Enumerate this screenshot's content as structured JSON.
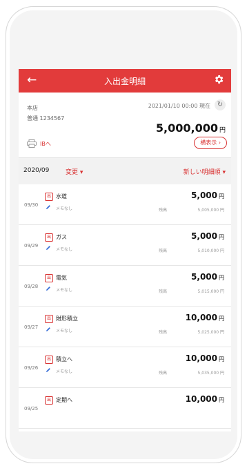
{
  "header": {
    "back_icon": "arrow-left-icon",
    "title": "入出金明細",
    "settings_icon": "gear-icon"
  },
  "account": {
    "branch": "本店",
    "account_type_number": "普通 1234567",
    "datetime": "2021/01/10 00:00 現在",
    "refresh_icon": "refresh-icon",
    "balance": "5,000,000",
    "currency": "円",
    "ib_link": "IBへ",
    "landscape_button": "横表示 ›",
    "print_icon": "printer-icon"
  },
  "filter": {
    "month": "2020/09",
    "change": "変更 ▾",
    "sort": "新しい明細順 ▾"
  },
  "transactions": [
    {
      "date": "09/30",
      "badge": "出",
      "desc": "水道",
      "memo": "メモなし",
      "amount": "5,000",
      "currency": "円",
      "balance_label": "残高",
      "balance": "5,005,000 円"
    },
    {
      "date": "09/29",
      "badge": "出",
      "desc": "ガス",
      "memo": "メモなし",
      "amount": "5,000",
      "currency": "円",
      "balance_label": "残高",
      "balance": "5,010,000 円"
    },
    {
      "date": "09/28",
      "badge": "出",
      "desc": "電気",
      "memo": "メモなし",
      "amount": "5,000",
      "currency": "円",
      "balance_label": "残高",
      "balance": "5,015,000 円"
    },
    {
      "date": "09/27",
      "badge": "出",
      "desc": "財形積立",
      "memo": "メモなし",
      "amount": "10,000",
      "currency": "円",
      "balance_label": "残高",
      "balance": "5,025,000 円"
    },
    {
      "date": "09/26",
      "badge": "出",
      "desc": "積立へ",
      "memo": "メモなし",
      "amount": "10,000",
      "currency": "円",
      "balance_label": "残高",
      "balance": "5,035,000 円"
    },
    {
      "date": "09/25",
      "badge": "出",
      "desc": "定期へ",
      "memo": "",
      "amount": "10,000",
      "currency": "円",
      "balance_label": "",
      "balance": ""
    }
  ],
  "colors": {
    "accent": "#e23b3b",
    "link": "#d93333"
  }
}
